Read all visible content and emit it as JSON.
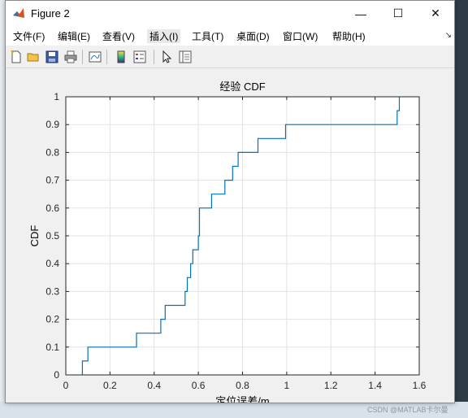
{
  "window": {
    "title": "Figure 2",
    "min_glyph": "—",
    "max_glyph": "☐",
    "close_glyph": "✕"
  },
  "menu": {
    "items": [
      "文件(F)",
      "编辑(E)",
      "查看(V)",
      "插入(I)",
      "工具(T)",
      "桌面(D)",
      "窗口(W)",
      "帮助(H)"
    ],
    "more_glyph": "↘"
  },
  "toolbar": {
    "icons": [
      "new-figure-icon",
      "open-icon",
      "save-icon",
      "print-icon",
      "link-plot-icon",
      "insert-colorbar-icon",
      "insert-legend-icon",
      "pointer-icon",
      "property-inspector-icon"
    ]
  },
  "footer": {
    "watermark": "CSDN @MATLAB卡尔曼"
  },
  "chart_data": {
    "type": "line",
    "title": "经验 CDF",
    "xlabel": "定位误差/m",
    "ylabel": "CDF",
    "xlim": [
      0,
      1.6
    ],
    "ylim": [
      0,
      1
    ],
    "xticks": [
      "0",
      "0.2",
      "0.4",
      "0.6",
      "0.8",
      "1",
      "1.2",
      "1.4",
      "1.6"
    ],
    "yticks": [
      "0",
      "0.1",
      "0.2",
      "0.3",
      "0.4",
      "0.5",
      "0.6",
      "0.7",
      "0.8",
      "0.9",
      "1"
    ],
    "grid": true,
    "line_color": "#0072bd",
    "series": [
      {
        "x": [
          0.075,
          0.075,
          0.1,
          0.1,
          0.32,
          0.32,
          0.43,
          0.43,
          0.45,
          0.45,
          0.54,
          0.54,
          0.55,
          0.55,
          0.565,
          0.565,
          0.575,
          0.575,
          0.6,
          0.6,
          0.605,
          0.605,
          0.66,
          0.66,
          0.72,
          0.72,
          0.755,
          0.755,
          0.78,
          0.78,
          0.87,
          0.87,
          0.995,
          0.995,
          1.05,
          1.05,
          1.5,
          1.5,
          1.51,
          1.51
        ],
        "y": [
          0,
          0.05,
          0.05,
          0.1,
          0.1,
          0.15,
          0.15,
          0.2,
          0.2,
          0.25,
          0.25,
          0.3,
          0.3,
          0.35,
          0.35,
          0.4,
          0.4,
          0.45,
          0.45,
          0.5,
          0.5,
          0.6,
          0.6,
          0.65,
          0.65,
          0.7,
          0.7,
          0.75,
          0.75,
          0.8,
          0.8,
          0.85,
          0.85,
          0.9,
          0.9,
          0.9,
          0.9,
          0.95,
          0.95,
          1.0
        ]
      }
    ]
  }
}
